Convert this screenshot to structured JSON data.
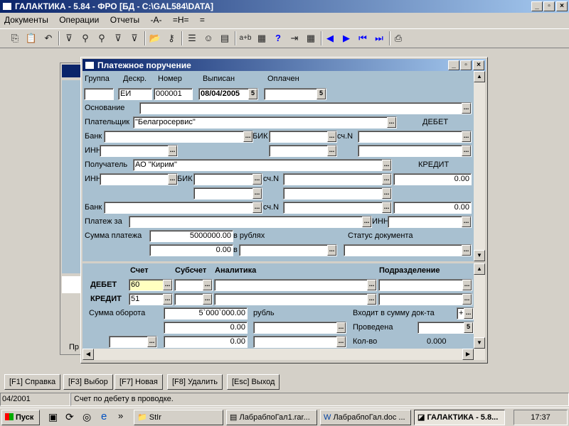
{
  "app": {
    "title": "ГАЛАКТИКА - 5.84 - ФРО [БД - C:\\GAL584\\DATA]",
    "menu": [
      "Документы",
      "Операции",
      "Отчеты",
      "-A-",
      "=H=",
      "="
    ]
  },
  "dialog": {
    "title": "Платежное поручение",
    "header_labels": {
      "group": "Группа",
      "descr": "Дескр.",
      "number": "Номер",
      "issued": "Выписан",
      "paid": "Оплачен"
    },
    "fields": {
      "group": "",
      "descr": "ЕИ",
      "number": "000001",
      "issued": "08/04/2005",
      "paid": "",
      "payer": "\"Белагросервис\"",
      "recipient": "АО \"Кирим\"",
      "credit_amount1": "0.00",
      "credit_amount2": "0.00",
      "payment_sum": "5000000.00",
      "payment_sum2": "0.00"
    },
    "labels": {
      "basis": "Основание",
      "payer": "Плательщик",
      "debit": "ДЕБЕТ",
      "bank": "Банк",
      "bik": "БИК",
      "acc": "сч.N",
      "inn": "ИНН",
      "recipient": "Получатель",
      "credit": "КРЕДИТ",
      "payment_for": "Платеж за",
      "payment_sum": "Сумма платежа",
      "in_rubles": "в рублях",
      "in": "в",
      "doc_status": "Статус документа"
    },
    "lower": {
      "col_account": "Счет",
      "col_subaccount": "Субсчет",
      "col_analytics": "Аналитика",
      "col_department": "Подразделение",
      "debit_label": "ДЕБЕТ",
      "credit_label": "КРЕДИТ",
      "debit_account": "60",
      "credit_account": "51",
      "turnover_label": "Сумма оборота",
      "turnover_value": "5`000`000.00",
      "currency": "рубль",
      "included_label": "Входит в сумму док-та",
      "included_value": "+",
      "posted_label": "Проведена",
      "amount2": "0.00",
      "amount3": "0.00",
      "qty_label": "Кол-во",
      "qty_value": "0.000"
    }
  },
  "fkeys": [
    "[F1] Справка",
    "[F3] Выбор",
    "[F7] Новая",
    "[F8] Удалить",
    "[Esc] Выход"
  ],
  "status": {
    "date": "04/2001",
    "message": "Счет по дебету в проводке."
  },
  "taskbar": {
    "start": "Пуск",
    "items": [
      "StIr",
      "ЛабрабпоГал1.rar...",
      "ЛабрабпоГал.doc ...",
      "ГАЛАКТИКА - 5.8..."
    ],
    "clock": "17:37"
  },
  "bg_window": {
    "label": "Пр"
  }
}
